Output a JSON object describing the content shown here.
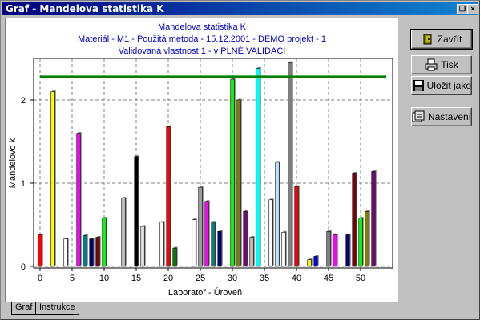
{
  "window": {
    "title": "Graf - Mandelova statistika K"
  },
  "chart": {
    "title_lines": [
      "Mandelova statistika K",
      "Materiál - M1 - Použitá metoda - 15.12.2001 - DEMO projekt - 1",
      "Validovaná vlastnost 1 - v PLNÉ VALIDACI"
    ],
    "colors": {
      "title": "#0000c0",
      "reference_line": "#008000"
    }
  },
  "buttons": {
    "close": "Zavřít",
    "print": "Tisk",
    "save": "Uložit jako",
    "settings": "Nastavení"
  },
  "tabs": [
    {
      "label": "Graf"
    },
    {
      "label": "Instrukce"
    }
  ],
  "chart_data": {
    "type": "bar",
    "xlabel": "Laboratoř - Úroveň",
    "ylabel": "Mandelovo k",
    "xlim": [
      -1,
      55
    ],
    "ylim": [
      -0.02,
      2.5
    ],
    "x_ticks": [
      0,
      5,
      10,
      15,
      20,
      25,
      30,
      35,
      40,
      45,
      50
    ],
    "y_ticks": [
      0,
      1,
      2
    ],
    "grid": true,
    "reference_line": 2.28,
    "bars": [
      {
        "x": 0,
        "value": 0.38,
        "color": "#ff0000"
      },
      {
        "x": 2,
        "value": 2.1,
        "color": "#ffff00"
      },
      {
        "x": 4,
        "value": 0.33,
        "color": "#ffffff"
      },
      {
        "x": 6,
        "value": 1.6,
        "color": "#ff00ff"
      },
      {
        "x": 7,
        "value": 0.37,
        "color": "#008080"
      },
      {
        "x": 8,
        "value": 0.33,
        "color": "#000080"
      },
      {
        "x": 9,
        "value": 0.35,
        "color": "#800000"
      },
      {
        "x": 10,
        "value": 0.58,
        "color": "#00ff00"
      },
      {
        "x": 13,
        "value": 0.82,
        "color": "#c0c0c0"
      },
      {
        "x": 15,
        "value": 1.32,
        "color": "#000000"
      },
      {
        "x": 16,
        "value": 0.48,
        "color": "#e0e0e0"
      },
      {
        "x": 19,
        "value": 0.53,
        "color": "#ffffff"
      },
      {
        "x": 20,
        "value": 1.68,
        "color": "#ff0000"
      },
      {
        "x": 21,
        "value": 0.22,
        "color": "#008000"
      },
      {
        "x": 24,
        "value": 0.56,
        "color": "#ffffff"
      },
      {
        "x": 25,
        "value": 0.95,
        "color": "#a0a0a0"
      },
      {
        "x": 26,
        "value": 0.78,
        "color": "#ff00ff"
      },
      {
        "x": 27,
        "value": 0.53,
        "color": "#008080"
      },
      {
        "x": 28,
        "value": 0.42,
        "color": "#000080"
      },
      {
        "x": 30,
        "value": 2.25,
        "color": "#00ff00"
      },
      {
        "x": 31,
        "value": 2.0,
        "color": "#808000"
      },
      {
        "x": 32,
        "value": 0.66,
        "color": "#800080"
      },
      {
        "x": 33,
        "value": 0.35,
        "color": "#c0c0c0"
      },
      {
        "x": 34,
        "value": 2.38,
        "color": "#00ffff"
      },
      {
        "x": 36,
        "value": 0.8,
        "color": "#ffffff"
      },
      {
        "x": 37,
        "value": 1.25,
        "color": "#c0e0ff"
      },
      {
        "x": 38,
        "value": 0.41,
        "color": "#ffffff"
      },
      {
        "x": 39,
        "value": 2.45,
        "color": "#808080"
      },
      {
        "x": 40,
        "value": 0.96,
        "color": "#ff0000"
      },
      {
        "x": 42,
        "value": 0.08,
        "color": "#ffff00"
      },
      {
        "x": 43,
        "value": 0.12,
        "color": "#0000ff"
      },
      {
        "x": 45,
        "value": 0.42,
        "color": "#808080"
      },
      {
        "x": 46,
        "value": 0.38,
        "color": "#ff00ff"
      },
      {
        "x": 48,
        "value": 0.38,
        "color": "#000080"
      },
      {
        "x": 49,
        "value": 1.12,
        "color": "#800000"
      },
      {
        "x": 50,
        "value": 0.58,
        "color": "#00ff00"
      },
      {
        "x": 51,
        "value": 0.66,
        "color": "#808000"
      },
      {
        "x": 52,
        "value": 1.14,
        "color": "#800080"
      }
    ]
  }
}
